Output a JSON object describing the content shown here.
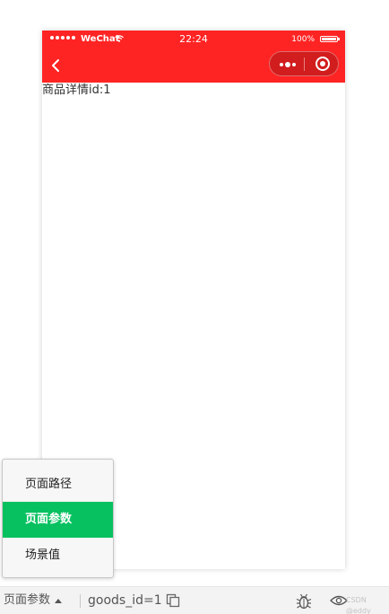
{
  "status_bar": {
    "carrier": "WeChat",
    "time": "22:24",
    "battery": "100%"
  },
  "navbar": {
    "background": "#ff2424",
    "back_icon": "chevron-left-icon",
    "more_icon": "more-dots-icon",
    "close_icon": "close-circle-icon"
  },
  "page": {
    "content_text": "商品详情id:1"
  },
  "popup_menu": {
    "items": [
      {
        "label": "页面路径",
        "active": false
      },
      {
        "label": "页面参数",
        "active": true
      },
      {
        "label": "场景值",
        "active": false
      }
    ],
    "active_color": "#07c160"
  },
  "bottom_bar": {
    "selected_option": "页面参数",
    "query": "goods_id=1",
    "copy_icon": "copy-icon",
    "bug_icon": "bug-icon",
    "eye_icon": "eye-icon",
    "watermark": "CSDN @eddy"
  }
}
